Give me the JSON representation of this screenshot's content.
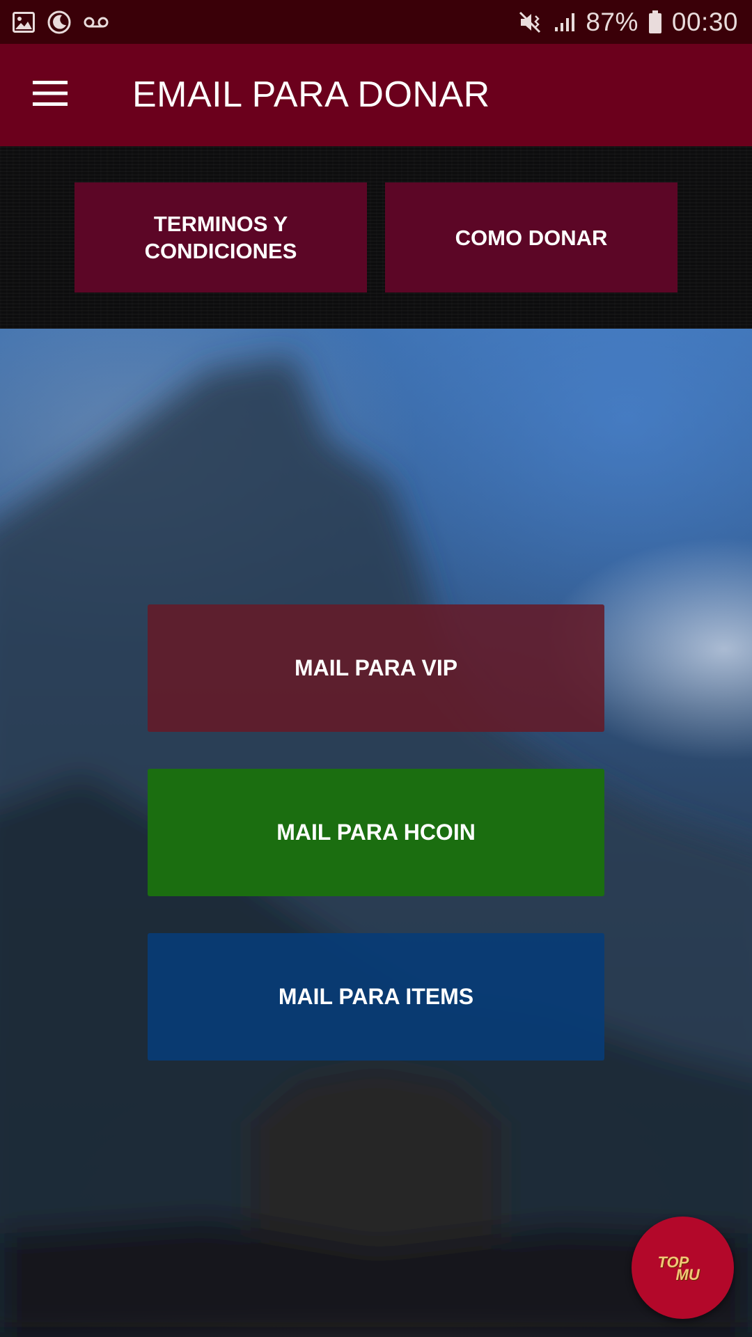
{
  "status_bar": {
    "battery": "87%",
    "time": "00:30",
    "icons": [
      "gallery-icon",
      "do-not-disturb-moon-icon",
      "voicemail-icon",
      "mute-icon",
      "signal-icon",
      "battery-icon"
    ]
  },
  "app_bar": {
    "title": "EMAIL PARA DONAR",
    "menu_icon": "hamburger-menu-icon",
    "color": "#6b001c"
  },
  "tabs": [
    {
      "label": "TERMINOS Y CONDICIONES"
    },
    {
      "label": "COMO DONAR"
    }
  ],
  "mail_buttons": {
    "vip": {
      "label": "MAIL PARA VIP",
      "color": "#641a28"
    },
    "hcoin": {
      "label": "MAIL PARA HCOIN",
      "color": "#1b6e10"
    },
    "items": {
      "label": "MAIL PARA ITEMS",
      "color": "#083c76"
    }
  },
  "fab": {
    "logo_text_top": "TOP",
    "logo_text_bottom": "MU",
    "color": "#b3082a"
  }
}
